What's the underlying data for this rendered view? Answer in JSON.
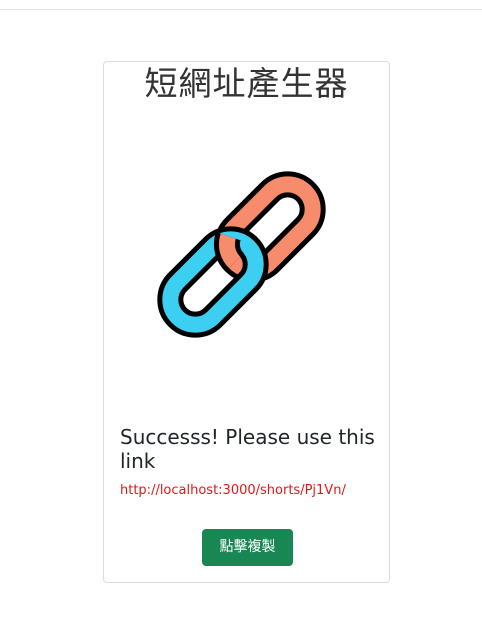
{
  "card": {
    "title": "短網址產生器",
    "message": "Successs! Please use this link",
    "short_url": "http://localhost:3000/shorts/Pj1Vn/",
    "copy_button_label": "點擊複製"
  },
  "icons": {
    "illustration": "chain-link-icon"
  },
  "colors": {
    "link_front": "#3ccff2",
    "link_back": "#f78c6c",
    "outline": "#000000",
    "url_text": "#e01818",
    "button": "#198754"
  }
}
